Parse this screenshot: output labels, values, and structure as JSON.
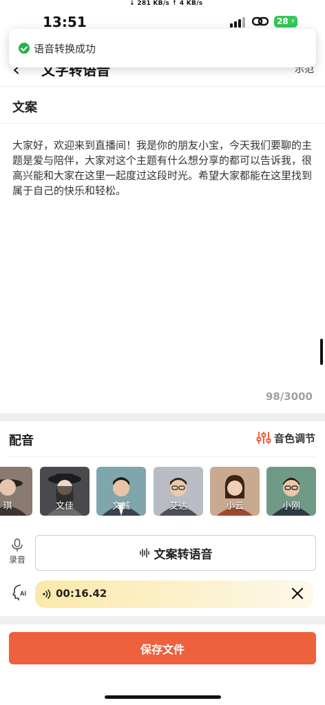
{
  "status_bar": {
    "time": "13:51",
    "net_speed": "↓ 281 KB/s   ↑ 4 KB/s",
    "battery": "28"
  },
  "nav": {
    "title": "文字转语音",
    "right_label": "示范"
  },
  "toast": {
    "message": "语音转换成功"
  },
  "copy_section": {
    "title": "文案",
    "text": "大家好，欢迎来到直播间！我是你的朋友小宝，今天我们要聊的主题是爱与陪伴，大家对这个主题有什么想分享的都可以告诉我，很高兴能和大家在这里一起度过这段时光。希望大家都能在这里找到属于自己的快乐和轻松。",
    "counter": "98/3000"
  },
  "dubbing": {
    "title": "配音",
    "timbre_label": "音色调节",
    "voices": [
      {
        "label": "琪",
        "bg": "#8a7a70"
      },
      {
        "label": "文佳",
        "bg": "#4a4a4e"
      },
      {
        "label": "文诚",
        "bg": "#7fa6ad"
      },
      {
        "label": "艾达",
        "bg": "#b9bcc2"
      },
      {
        "label": "小云",
        "bg": "#c9a98f"
      },
      {
        "label": "小刚",
        "bg": "#6f9a86"
      }
    ]
  },
  "record": {
    "label": "录音"
  },
  "tts_button": {
    "label": "文案转语音"
  },
  "player": {
    "time": "00:16.42"
  },
  "save_button": {
    "label": "保存文件"
  },
  "colors": {
    "accent": "#ef603d",
    "success": "#27b14b",
    "battery": "#34c759"
  }
}
